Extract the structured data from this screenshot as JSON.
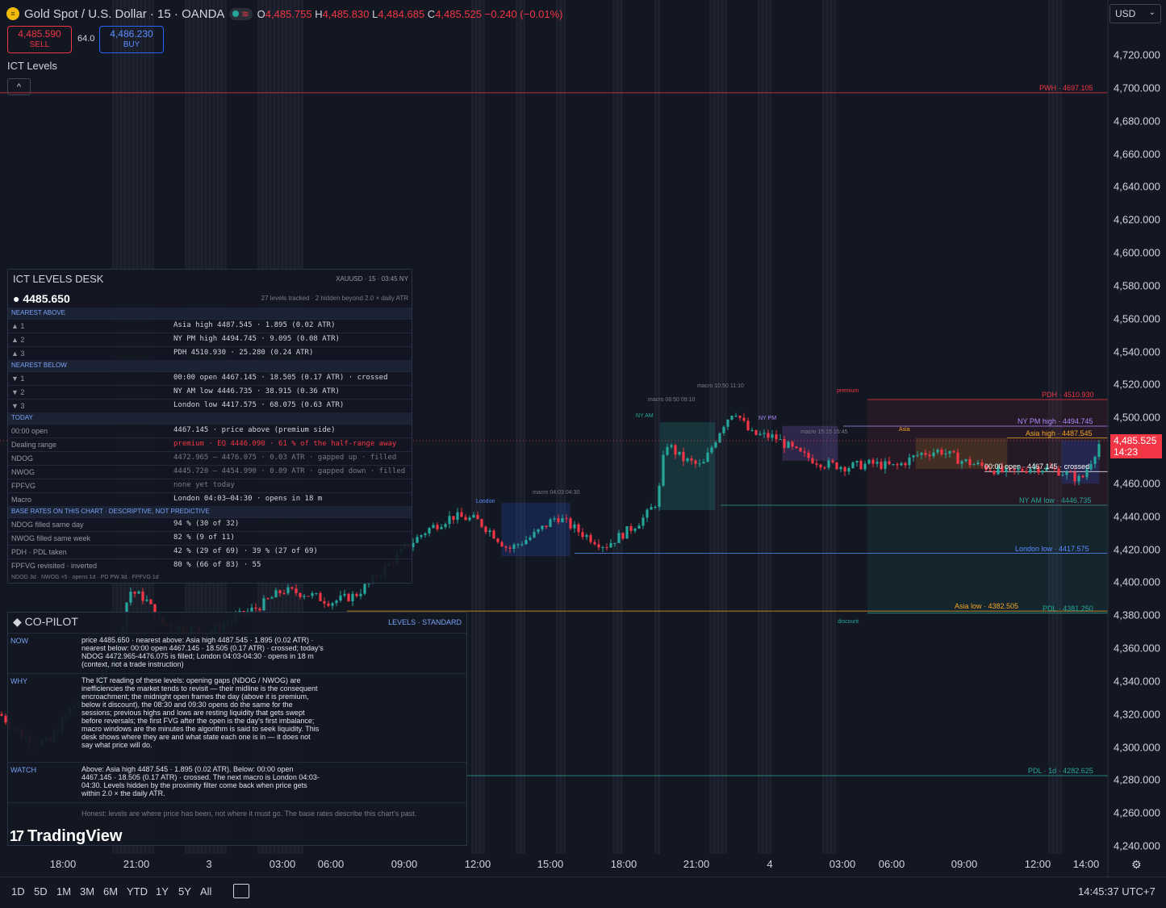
{
  "header": {
    "symbol_title": "Gold Spot / U.S. Dollar · 15 · OANDA",
    "ohlc": [
      {
        "key": "O",
        "value": "4,485.755"
      },
      {
        "key": "H",
        "value": "4,485.830"
      },
      {
        "key": "L",
        "value": "4,484.685"
      },
      {
        "key": "C",
        "value": "4,485.525"
      }
    ],
    "change": "−0.240 (−0.01%)",
    "sell_price": "4,485.590",
    "sell_label": "SELL",
    "buy_price": "4,486.230",
    "buy_label": "BUY",
    "spread": "64.0",
    "indicator_label": "ICT Levels",
    "currency": "USD"
  },
  "price_axis": {
    "ticks": [
      "4,720.000",
      "4,700.000",
      "4,680.000",
      "4,660.000",
      "4,640.000",
      "4,620.000",
      "4,600.000",
      "4,580.000",
      "4,560.000",
      "4,540.000",
      "4,520.000",
      "4,500.000",
      "4,460.000",
      "4,440.000",
      "4,420.000",
      "4,400.000",
      "4,380.000",
      "4,360.000",
      "4,340.000",
      "4,320.000",
      "4,300.000",
      "4,280.000",
      "4,260.000",
      "4,240.000"
    ],
    "tick_values": [
      4720,
      4700,
      4680,
      4660,
      4640,
      4620,
      4600,
      4580,
      4560,
      4540,
      4520,
      4500,
      4460,
      4440,
      4420,
      4400,
      4380,
      4360,
      4340,
      4320,
      4300,
      4280,
      4260,
      4240
    ],
    "current_price": "4,485.525",
    "countdown": "14:23"
  },
  "time_axis": [
    "18:00",
    "21:00",
    "3",
    "03:00",
    "06:00",
    "09:00",
    "12:00",
    "15:00",
    "18:00",
    "21:00",
    "4",
    "03:00",
    "06:00",
    "09:00",
    "12:00",
    "14:00"
  ],
  "levels": [
    {
      "label": "PWH · 4697.105",
      "color": "#f23645"
    },
    {
      "label": "PDH · 4510.930",
      "color": "#f23645"
    },
    {
      "label": "NY PM high · 4494.745",
      "color": "#b388ff"
    },
    {
      "label": "Asia high · 4487.545",
      "color": "#f5a623"
    },
    {
      "label": "NY AM low · 4446.735",
      "color": "#26a69a"
    },
    {
      "label": "London low · 4417.575",
      "color": "#5b8cff"
    },
    {
      "label": "Asia low · 4382.505",
      "color": "#f5a623"
    },
    {
      "label": "PDL · 4381.250",
      "color": "#26a69a"
    },
    {
      "label": "PDL · 1d · 4282.625",
      "color": "#26a69a"
    },
    {
      "label": "00:00 open · 4467.145 · crossed",
      "color": "#ffffff"
    }
  ],
  "annotations": {
    "premium": "premium",
    "discount": "discount",
    "london": "London",
    "asia": "Asia",
    "ny_am": "NY AM",
    "ny_pm": "NY PM",
    "macro_1": "macro 08:50 09:10",
    "macro_2": "macro 10:50 11:10",
    "macro_3": "macro 04:03 04:30",
    "macro_4": "macro 15:15 15:45"
  },
  "desk": {
    "title": "ICT LEVELS DESK",
    "symbol_meta": "XAUUSD · 15 · 03:45 NY",
    "price": "● 4485.650",
    "tracked": "27 levels tracked · 2 hidden beyond 2.0 × daily ATR",
    "sections": [
      "NEAREST ABOVE",
      "NEAREST BELOW",
      "TODAY",
      "BASE RATES ON THIS CHART · DESCRIPTIVE, NOT PREDICTIVE"
    ],
    "above": [
      {
        "k": "▲ 1",
        "v": "Asia high 4487.545 · 1.895 (0.02 ATR)"
      },
      {
        "k": "▲ 2",
        "v": "NY PM high 4494.745 · 9.095 (0.08 ATR)"
      },
      {
        "k": "▲ 3",
        "v": "PDH 4510.930 · 25.280 (0.24 ATR)"
      }
    ],
    "below": [
      {
        "k": "▼ 1",
        "v": "00:00 open 4467.145 · 18.505 (0.17 ATR) · crossed"
      },
      {
        "k": "▼ 2",
        "v": "NY AM low 4446.735 · 38.915 (0.36 ATR)"
      },
      {
        "k": "▼ 3",
        "v": "London low 4417.575 · 68.075 (0.63 ATR)"
      }
    ],
    "today": [
      {
        "k": "00:00 open",
        "v": "4467.145 · price above (premium side)"
      },
      {
        "k": "Dealing range",
        "v": "premium · EQ 4446.090 · 61 % of the half-range away"
      },
      {
        "k": "NDOG",
        "v": "4472.965 – 4476.075 · 0.03 ATR · gapped up · filled"
      },
      {
        "k": "NWOG",
        "v": "4445.720 – 4454.990 · 0.09 ATR · gapped down · filled"
      },
      {
        "k": "FPFVG",
        "v": "none yet today"
      },
      {
        "k": "Macro",
        "v": "London 04:03–04:30 · opens in 18 m"
      }
    ],
    "base_rates": [
      {
        "k": "NDOG filled same day",
        "v": "94 % (30 of 32)"
      },
      {
        "k": "NWOG filled same week",
        "v": "82 % (9 of 11)"
      },
      {
        "k": "PDH · PDL taken",
        "v": "42 % (29 of 69) · 39 % (27 of 69)"
      },
      {
        "k": "FPFVG revisited · inverted",
        "v": "80 % (66 of 83) · 55"
      }
    ],
    "footer": "NDOG 3d · NWOG ×5 · opens 1d · PD PW 3d · FPFVG 1d"
  },
  "copilot": {
    "title": "◆ CO-PILOT",
    "mode": "LEVELS · STANDARD",
    "rows": [
      {
        "k": "NOW",
        "t": "price 4485.650 · nearest above: Asia high 4487.545 · 1.895 (0.02 ATR) · nearest below: 00:00 open 4467.145 · 18.505 (0.17 ATR) · crossed; today's NDOG 4472.965-4476.075 is filled; London 04:03-04:30 · opens in 18 m (context, not a trade instruction)"
      },
      {
        "k": "WHY",
        "t": "The ICT reading of these levels: opening gaps (NDOG / NWOG) are inefficiencies the market tends to revisit — their midline is the consequent encroachment; the midnight open frames the day (above it is premium, below it discount), the 08:30 and 09:30 opens do the same for the sessions; previous highs and lows are resting liquidity that gets swept before reversals; the first FVG after the open is the day's first imbalance; macro windows are the minutes the algorithm is said to seek liquidity. This desk shows where they are and what state each one is in — it does not say what price will do."
      },
      {
        "k": "WATCH",
        "t": "Above: Asia high 4487.545 · 1.895 (0.02 ATR). Below: 00:00 open 4467.145 · 18.505 (0.17 ATR) · crossed. The next macro is London 04:03-04:30. Levels hidden by the proximity filter come back when price gets within 2.0 × the daily ATR."
      }
    ],
    "honest": "Honest: levels are where price has been, not where it must go. The base rates describe this chart's past."
  },
  "bottom_bar": {
    "timeframes": [
      "1D",
      "5D",
      "1M",
      "3M",
      "6M",
      "YTD",
      "1Y",
      "5Y",
      "All"
    ],
    "clock": "14:45:37 UTC+7"
  },
  "brand": "TradingView",
  "colors": {
    "up": "#26a69a",
    "down": "#f23645",
    "bg": "#131722",
    "accent": "#2962ff"
  }
}
